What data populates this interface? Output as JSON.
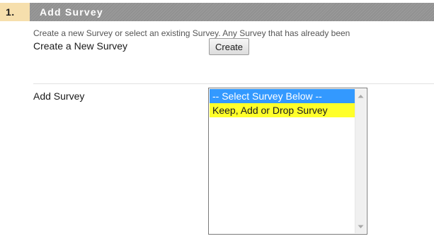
{
  "section": {
    "number": "1.",
    "title": "Add Survey",
    "instructions": "Create a new Survey or select an existing Survey. Any Survey that has already been"
  },
  "create_row": {
    "label": "Create a New Survey",
    "button_label": "Create"
  },
  "add_row": {
    "label": "Add Survey",
    "options": [
      {
        "label": "-- Select Survey Below --",
        "state": "selected"
      },
      {
        "label": "Keep, Add or Drop Survey",
        "state": "highlighted"
      }
    ]
  },
  "colors": {
    "step_bg": "#f6dfad",
    "title_bar": "#8e8e8e",
    "selection": "#3399ff",
    "highlight": "#ffff2a"
  },
  "icons": {
    "scroll_up": "scroll-up-arrow-icon",
    "scroll_down": "scroll-down-arrow-icon"
  }
}
